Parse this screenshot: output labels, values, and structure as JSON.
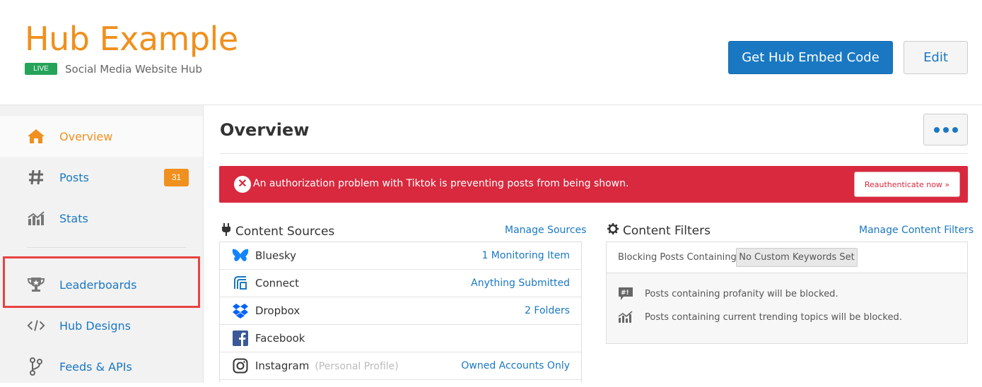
{
  "header": {
    "title": "Hub Example",
    "live_badge": "LIVE",
    "subtitle": "Social Media Website Hub",
    "embed_button": "Get Hub Embed Code",
    "edit_button": "Edit"
  },
  "sidebar": {
    "items": [
      {
        "label": "Overview",
        "icon": "home-icon",
        "active": true
      },
      {
        "label": "Posts",
        "icon": "hash-icon",
        "badge": "31"
      },
      {
        "label": "Stats",
        "icon": "chart-icon"
      },
      {
        "label": "Leaderboards",
        "icon": "trophy-icon"
      },
      {
        "label": "Hub Designs",
        "icon": "code-icon"
      },
      {
        "label": "Feeds & APIs",
        "icon": "fork-icon"
      }
    ]
  },
  "main": {
    "title": "Overview",
    "alert": {
      "message": "An authorization problem with Tiktok is preventing posts from being shown.",
      "button": "Reauthenticate now »"
    },
    "content_sources": {
      "heading": "Content Sources",
      "manage_link": "Manage Sources",
      "rows": [
        {
          "name": "Bluesky",
          "detail": "1 Monitoring Item",
          "icon": "bluesky-icon"
        },
        {
          "name": "Connect",
          "detail": "Anything Submitted",
          "icon": "connect-icon"
        },
        {
          "name": "Dropbox",
          "detail": "2 Folders",
          "icon": "dropbox-icon"
        },
        {
          "name": "Facebook",
          "detail": "",
          "icon": "facebook-icon"
        },
        {
          "name": "Instagram",
          "note": "(Personal Profile)",
          "detail": "Owned Accounts Only",
          "icon": "instagram-icon"
        }
      ]
    },
    "content_filters": {
      "heading": "Content Filters",
      "manage_link": "Manage Content Filters",
      "blocking_label": "Blocking Posts Containing:",
      "keyword_tag": "No Custom Keywords Set",
      "rules": [
        {
          "text": "Posts containing profanity will be blocked.",
          "icon": "profanity-icon"
        },
        {
          "text": "Posts containing current trending topics will be blocked.",
          "icon": "trending-icon"
        }
      ]
    }
  },
  "colors": {
    "brand_orange": "#f0901e",
    "link_blue": "#1a78c2",
    "alert_red": "#d8293e",
    "live_green": "#25a35a",
    "highlight_red": "#e84343"
  }
}
